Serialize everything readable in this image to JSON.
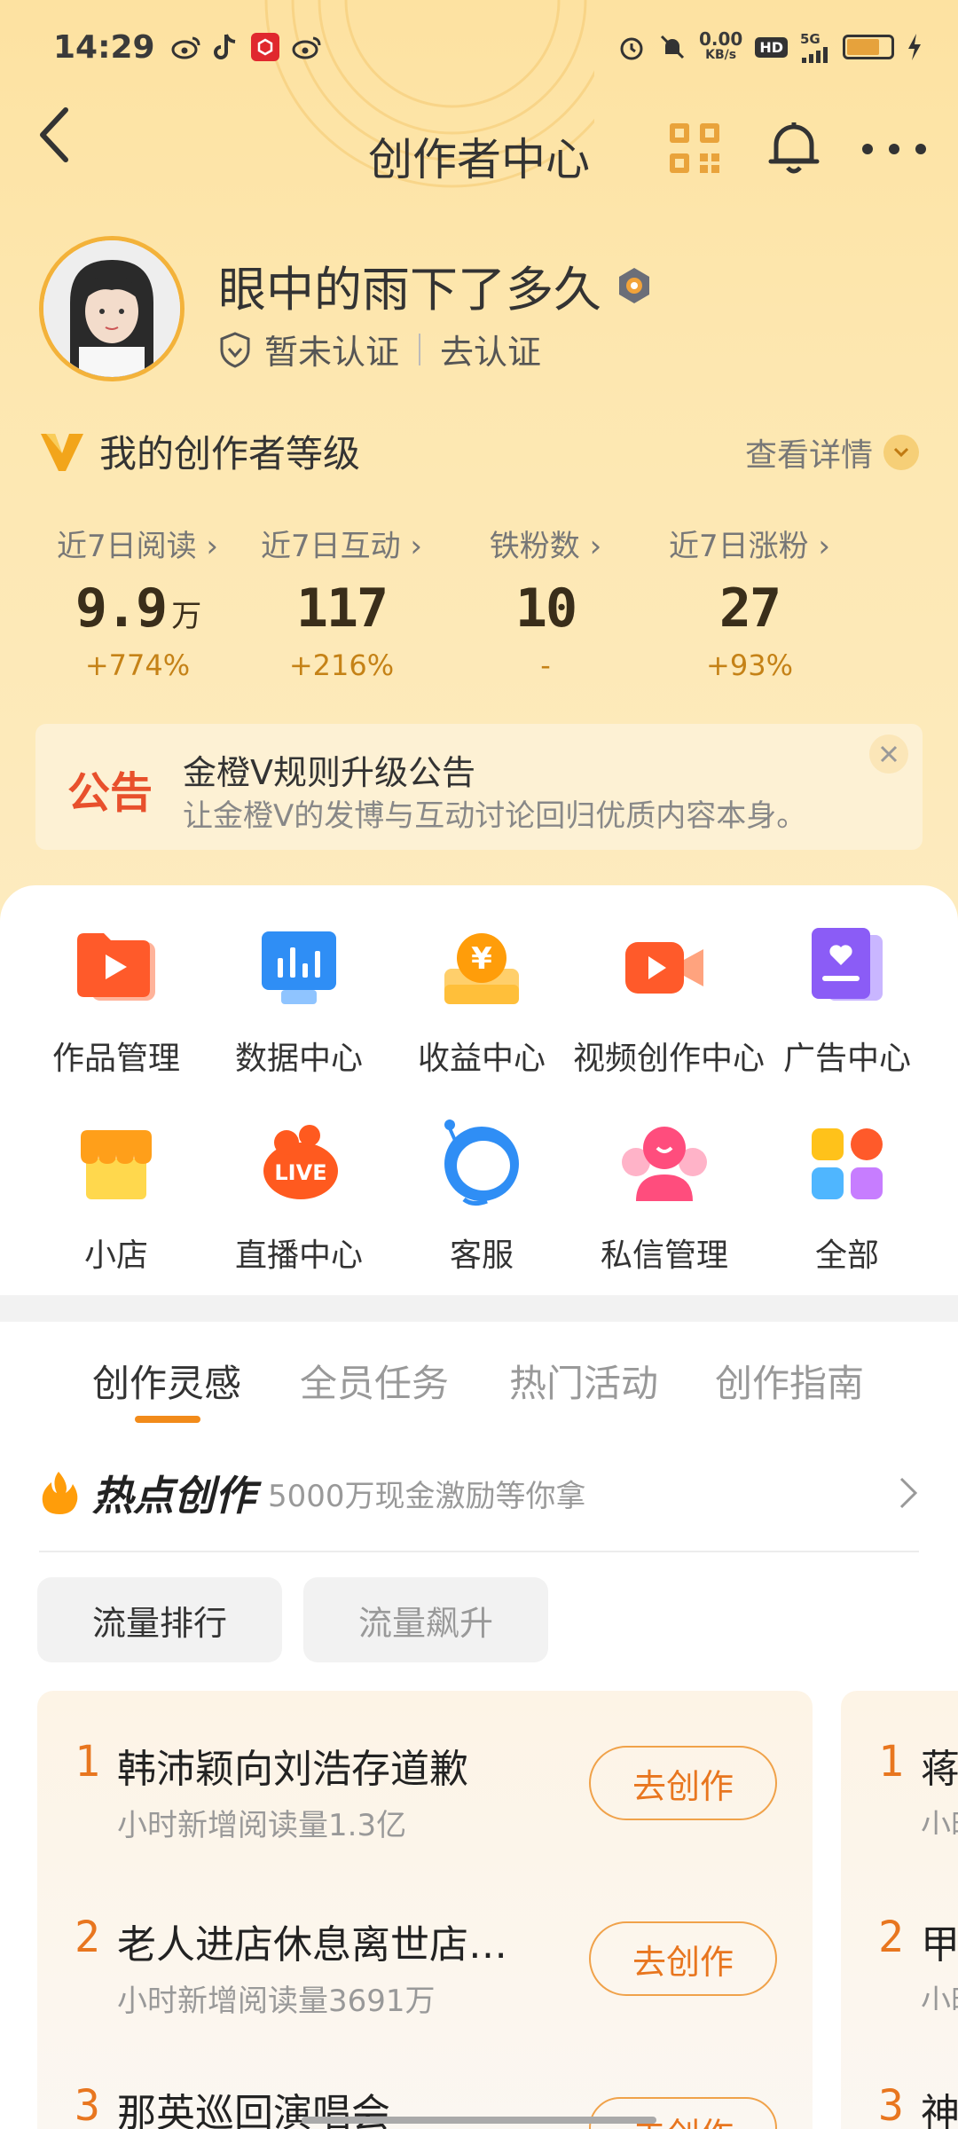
{
  "status_bar": {
    "time": "14:29",
    "net_speed": "0.00",
    "net_unit": "KB/s",
    "hd": "HD",
    "signal": "5G",
    "battery_level": 0.75
  },
  "header": {
    "title": "创作者中心"
  },
  "profile": {
    "name": "眼中的雨下了多久",
    "verify_status": "暂未认证",
    "verify_action": "去认证"
  },
  "level": {
    "title": "我的创作者等级",
    "more": "查看详情"
  },
  "stats": [
    {
      "label": "近7日阅读",
      "value": "9.9",
      "unit": "万",
      "change": "+774%"
    },
    {
      "label": "近7日互动",
      "value": "117",
      "unit": "",
      "change": "+216%"
    },
    {
      "label": "铁粉数",
      "value": "10",
      "unit": "",
      "change": "-"
    },
    {
      "label": "近7日涨粉",
      "value": "27",
      "unit": "",
      "change": "+93%"
    }
  ],
  "notice": {
    "tag": "公告",
    "title": "金橙V规则升级公告",
    "text": "让金橙V的发博与互动讨论回归优质内容本身。"
  },
  "tools": [
    {
      "label": "作品管理",
      "icon": "works-icon"
    },
    {
      "label": "数据中心",
      "icon": "data-center-icon"
    },
    {
      "label": "收益中心",
      "icon": "income-icon"
    },
    {
      "label": "视频创作中心",
      "icon": "video-icon"
    },
    {
      "label": "广告中心",
      "icon": "ad-icon"
    },
    {
      "label": "小店",
      "icon": "shop-icon"
    },
    {
      "label": "直播中心",
      "icon": "live-icon"
    },
    {
      "label": "客服",
      "icon": "service-icon"
    },
    {
      "label": "私信管理",
      "icon": "message-icon"
    },
    {
      "label": "全部",
      "icon": "all-icon"
    }
  ],
  "tabs": [
    "创作灵感",
    "全员任务",
    "热门活动",
    "创作指南"
  ],
  "hot": {
    "title": "热点创作",
    "subtitle": "5000万现金激励等你拿"
  },
  "chips": [
    "流量排行",
    "流量飙升"
  ],
  "trending": [
    {
      "rank": "1",
      "title": "韩沛颖向刘浩存道歉",
      "stat": "小时新增阅读量1.3亿",
      "action": "去创作"
    },
    {
      "rank": "2",
      "title": "老人进店休息离世店…",
      "stat": "小时新增阅读量3691万",
      "action": "去创作"
    },
    {
      "rank": "3",
      "title": "那英巡回演唱会",
      "stat": "",
      "action": "去创作"
    }
  ],
  "trending_peek": [
    {
      "rank": "1",
      "title": "蒋",
      "stat": "小时"
    },
    {
      "rank": "2",
      "title": "甲",
      "stat": "小时"
    },
    {
      "rank": "3",
      "title": "神",
      "stat": ""
    }
  ],
  "colors": {
    "accent": "#f28b1a",
    "header_bg": "#fde2a1",
    "notice_tag": "#e8502c"
  }
}
